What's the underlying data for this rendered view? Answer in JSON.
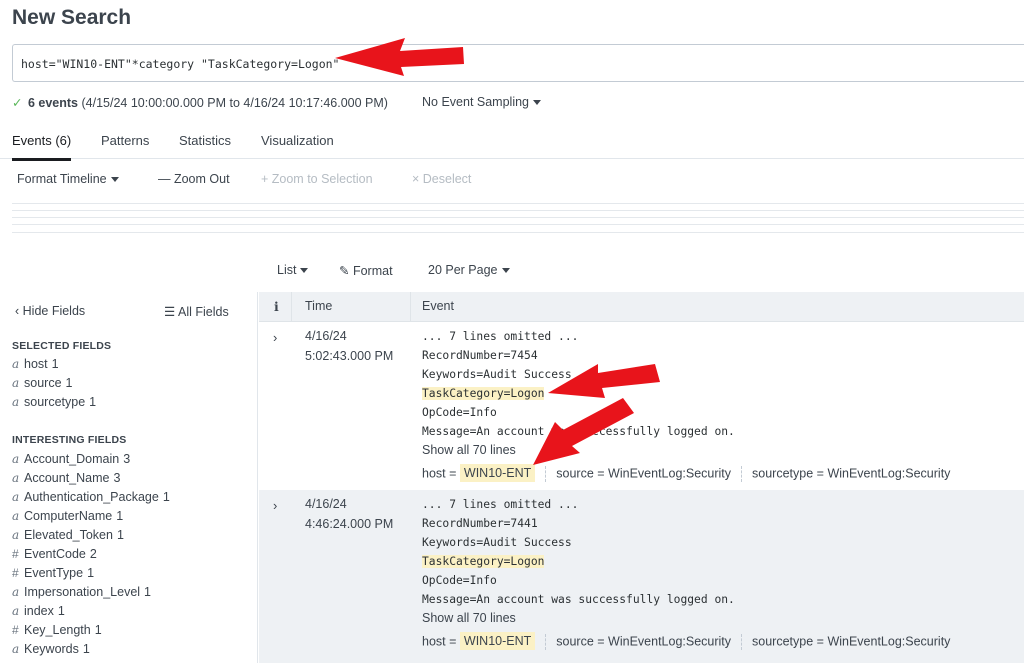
{
  "page": {
    "title": "New Search"
  },
  "search": {
    "query": "host=\"WIN10-ENT\"*category \"TaskCategory=Logon\""
  },
  "status": {
    "count": "6 events",
    "range": "(4/15/24 10:00:00.000 PM to 4/16/24 10:17:46.000 PM)",
    "sampling": "No Event Sampling"
  },
  "tabs": [
    "Events (6)",
    "Patterns",
    "Statistics",
    "Visualization"
  ],
  "timeline_toolbar": {
    "format": "Format Timeline",
    "zoom_out": "— Zoom Out",
    "zoom_sel": "+ Zoom to Selection",
    "deselect": "× Deselect"
  },
  "list_toolbar": {
    "list": "List",
    "format": "Format",
    "per_page": "20 Per Page"
  },
  "sidebar": {
    "hide": "‹ Hide Fields",
    "all": "All Fields",
    "selected_heading": "SELECTED FIELDS",
    "interesting_heading": "INTERESTING FIELDS",
    "selected": [
      {
        "type": "a",
        "name": "host",
        "count": "1"
      },
      {
        "type": "a",
        "name": "source",
        "count": "1"
      },
      {
        "type": "a",
        "name": "sourcetype",
        "count": "1"
      }
    ],
    "interesting": [
      {
        "type": "a",
        "name": "Account_Domain",
        "count": "3"
      },
      {
        "type": "a",
        "name": "Account_Name",
        "count": "3"
      },
      {
        "type": "a",
        "name": "Authentication_Package",
        "count": "1"
      },
      {
        "type": "a",
        "name": "ComputerName",
        "count": "1"
      },
      {
        "type": "a",
        "name": "Elevated_Token",
        "count": "1"
      },
      {
        "type": "#",
        "name": "EventCode",
        "count": "2"
      },
      {
        "type": "#",
        "name": "EventType",
        "count": "1"
      },
      {
        "type": "a",
        "name": "Impersonation_Level",
        "count": "1"
      },
      {
        "type": "a",
        "name": "index",
        "count": "1"
      },
      {
        "type": "#",
        "name": "Key_Length",
        "count": "1"
      },
      {
        "type": "a",
        "name": "Keywords",
        "count": "1"
      }
    ]
  },
  "table": {
    "col_i": "i",
    "col_time": "Time",
    "col_event": "Event"
  },
  "events": [
    {
      "date": "4/16/24",
      "time": "5:02:43.000 PM",
      "omitted": "... 7 lines omitted ...",
      "record": "RecordNumber=7454",
      "keywords": "Keywords=Audit Success",
      "taskcat": "TaskCategory=Logon",
      "opcode": "OpCode=Info",
      "message": "Message=An account was successfully logged on.",
      "show_all": "Show all 70 lines",
      "host_label": "host =",
      "host": "WIN10-ENT",
      "source_label": "source =",
      "source": "WinEventLog:Security",
      "sourcetype_label": "sourcetype =",
      "sourcetype": "WinEventLog:Security"
    },
    {
      "date": "4/16/24",
      "time": "4:46:24.000 PM",
      "omitted": "... 7 lines omitted ...",
      "record": "RecordNumber=7441",
      "keywords": "Keywords=Audit Success",
      "taskcat": "TaskCategory=Logon",
      "opcode": "OpCode=Info",
      "message": "Message=An account was successfully logged on.",
      "show_all": "Show all 70 lines",
      "host_label": "host =",
      "host": "WIN10-ENT",
      "source_label": "source =",
      "source": "WinEventLog:Security",
      "sourcetype_label": "sourcetype =",
      "sourcetype": "WinEventLog:Security"
    }
  ],
  "colors": {
    "accent": "#5cb85c",
    "highlight": "#fbf1c5",
    "arrow": "#e8141b"
  }
}
